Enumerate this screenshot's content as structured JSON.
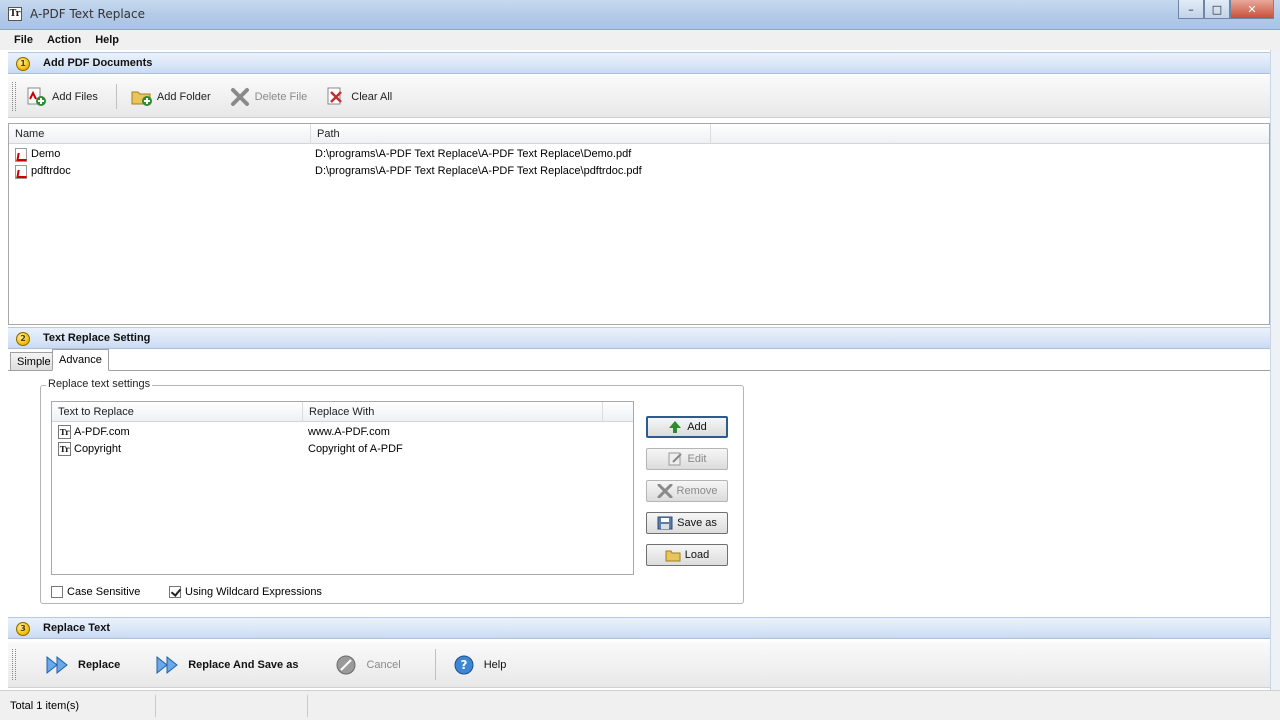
{
  "window": {
    "title": "A-PDF Text Replace",
    "min": "–",
    "max": "□",
    "close": "✕",
    "app_icon_text": "Tr"
  },
  "menu": [
    {
      "label": "File"
    },
    {
      "label": "Action"
    },
    {
      "label": "Help"
    }
  ],
  "step1": {
    "number": "1",
    "title": "Add PDF Documents"
  },
  "files_toolbar": {
    "add_files": "Add Files",
    "add_folder": "Add Folder",
    "delete_file": "Delete File",
    "clear_all": "Clear All"
  },
  "file_list": {
    "columns": [
      "Name",
      "Path"
    ],
    "rows": [
      {
        "name": "Demo",
        "path": "D:\\programs\\A-PDF Text Replace\\A-PDF Text Replace\\Demo.pdf"
      },
      {
        "name": "pdftrdoc",
        "path": "D:\\programs\\A-PDF Text Replace\\A-PDF Text Replace\\pdftrdoc.pdf"
      }
    ]
  },
  "step2": {
    "number": "2",
    "title": "Text Replace Setting"
  },
  "tabs": {
    "simple": "Simple",
    "advance": "Advance"
  },
  "replace_settings": {
    "legend": "Replace text settings",
    "columns": [
      "Text to Replace",
      "Replace With"
    ],
    "rows": [
      {
        "find": "A-PDF.com",
        "replace": "www.A-PDF.com"
      },
      {
        "find": "Copyright",
        "replace": "Copyright of A-PDF"
      }
    ],
    "buttons": {
      "add": "Add",
      "edit": "Edit",
      "remove": "Remove",
      "save_as": "Save as",
      "load": "Load"
    },
    "case_sensitive": "Case Sensitive",
    "wildcard": "Using Wildcard Expressions",
    "case_sensitive_checked": false,
    "wildcard_checked": true
  },
  "step3": {
    "number": "3",
    "title": "Replace Text"
  },
  "actions": {
    "replace": "Replace",
    "replace_save_as": "Replace And Save as",
    "cancel": "Cancel",
    "help": "Help"
  },
  "status": {
    "text": "Total 1 item(s)"
  },
  "colors": {
    "header_blue": "#d9e6f7",
    "accent_green": "#2e8b2e",
    "icon_blue": "#2f7fd1"
  }
}
